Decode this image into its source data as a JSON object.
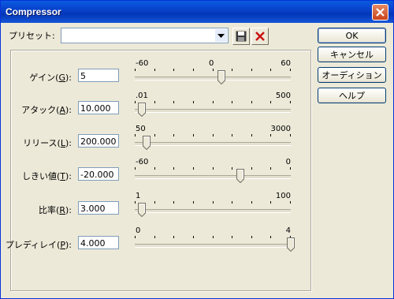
{
  "window": {
    "title": "Compressor"
  },
  "preset": {
    "label": "プリセット:",
    "value": ""
  },
  "buttons": {
    "ok": "OK",
    "cancel": "キャンセル",
    "audition": "オーディション(A)",
    "help": "ヘルプ"
  },
  "params": [
    {
      "label_pre": "ゲイン(",
      "mnemonic": "G",
      "label_post": "):",
      "value": "5",
      "min_label": "-60",
      "mid_label": "0",
      "max_label": "60",
      "min": -60,
      "max": 60,
      "current": 5
    },
    {
      "label_pre": "アタック(",
      "mnemonic": "A",
      "label_post": "):",
      "value": "10.000",
      "min_label": ".01",
      "mid_label": "",
      "max_label": "500",
      "min": 0.01,
      "max": 500,
      "current": 10
    },
    {
      "label_pre": "リリース(",
      "mnemonic": "L",
      "label_post": "):",
      "value": "200.000",
      "min_label": "50",
      "mid_label": "",
      "max_label": "3000",
      "min": 50,
      "max": 3000,
      "current": 200
    },
    {
      "label_pre": "しきい値(",
      "mnemonic": "T",
      "label_post": "):",
      "value": "-20.000",
      "min_label": "-60",
      "mid_label": "",
      "max_label": "0",
      "min": -60,
      "max": 0,
      "current": -20
    },
    {
      "label_pre": "比率(",
      "mnemonic": "R",
      "label_post": "):",
      "value": "3.000",
      "min_label": "1",
      "mid_label": "",
      "max_label": "100",
      "min": 1,
      "max": 100,
      "current": 3
    },
    {
      "label_pre": "プレディレイ(",
      "mnemonic": "P",
      "label_post": "):",
      "value": "4.000",
      "min_label": "0",
      "mid_label": "",
      "max_label": "4",
      "min": 0,
      "max": 4,
      "current": 4
    }
  ]
}
